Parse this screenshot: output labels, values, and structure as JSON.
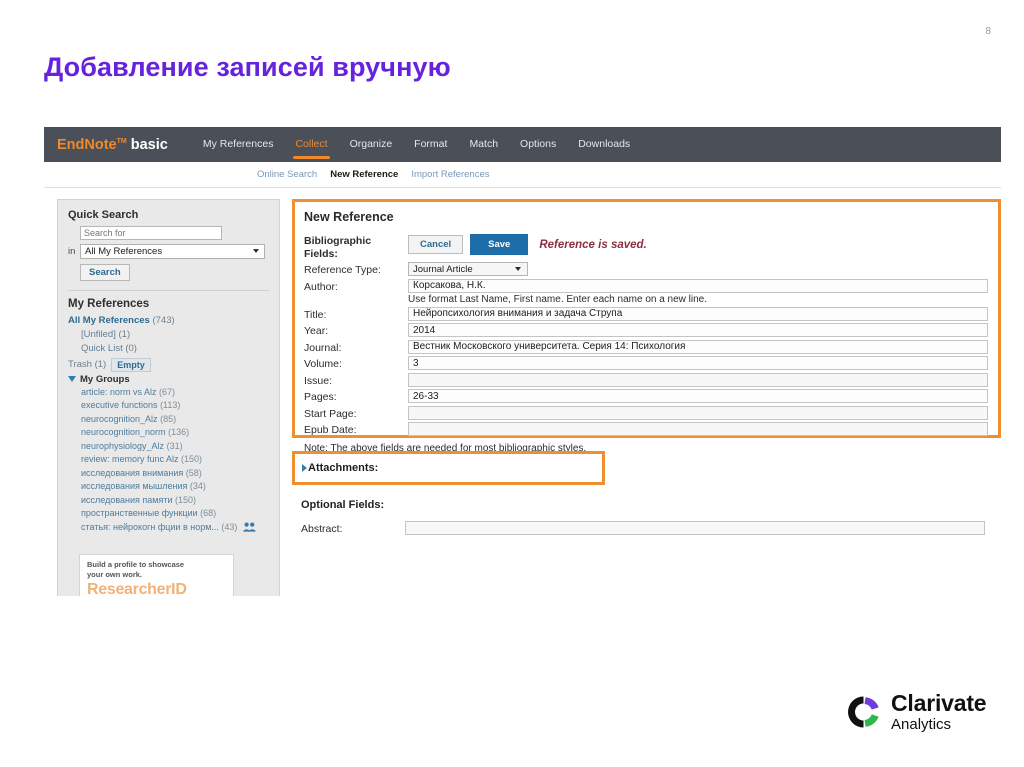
{
  "slide": {
    "number": "8",
    "title": "Добавление записей вручную"
  },
  "nav": {
    "brand_en": "EndNote",
    "brand_tm": "TM",
    "brand_basic": "basic",
    "items": [
      {
        "label": "My References",
        "active": false
      },
      {
        "label": "Collect",
        "active": true
      },
      {
        "label": "Organize",
        "active": false
      },
      {
        "label": "Format",
        "active": false
      },
      {
        "label": "Match",
        "active": false
      },
      {
        "label": "Options",
        "active": false
      },
      {
        "label": "Downloads",
        "active": false
      }
    ],
    "subnav": [
      {
        "label": "Online Search",
        "current": false
      },
      {
        "label": "New Reference",
        "current": true
      },
      {
        "label": "Import References",
        "current": false
      }
    ]
  },
  "sidebar": {
    "quick_search_heading": "Quick Search",
    "search_placeholder": "Search for",
    "in_label": "in",
    "scope_selected": "All My References",
    "search_button": "Search",
    "my_references_heading": "My References",
    "all_refs_label": "All My References",
    "all_refs_count": "(743)",
    "unfiled_label": "[Unfiled]",
    "unfiled_count": "(1)",
    "quick_list_label": "Quick List",
    "quick_list_count": "(0)",
    "trash_label": "Trash",
    "trash_count": "(1)",
    "empty_button": "Empty",
    "my_groups_label": "My Groups",
    "groups": [
      {
        "label": "article: norm vs Alz",
        "count": "(67)",
        "shared": false
      },
      {
        "label": "executive functions",
        "count": "(113)",
        "shared": false
      },
      {
        "label": "neurocognition_Alz",
        "count": "(85)",
        "shared": false
      },
      {
        "label": "neurocognition_norm",
        "count": "(136)",
        "shared": false
      },
      {
        "label": "neurophysiology_Alz",
        "count": "(31)",
        "shared": false
      },
      {
        "label": "review: memory func Alz",
        "count": "(150)",
        "shared": false
      },
      {
        "label": "исследования внимания",
        "count": "(58)",
        "shared": false
      },
      {
        "label": "исследования мышления",
        "count": "(34)",
        "shared": false
      },
      {
        "label": "исследования памяти",
        "count": "(150)",
        "shared": false
      },
      {
        "label": "пространственные функции",
        "count": "(68)",
        "shared": false
      },
      {
        "label": "статья: нейрокогн фции в норм...",
        "count": "(43)",
        "shared": true
      }
    ],
    "promo_line1": "Build a profile to showcase",
    "promo_line2": "your own work.",
    "promo_brand": "ResearcherID"
  },
  "main": {
    "panel_title": "New Reference",
    "bibliographic_label_l1": "Bibliographic",
    "bibliographic_label_l2": "Fields:",
    "cancel_button": "Cancel",
    "save_button": "Save",
    "saved_message": "Reference is saved.",
    "reference_type_label": "Reference Type:",
    "reference_type_value": "Journal Article",
    "author_label": "Author:",
    "author_value": "Корсакова, Н.К.",
    "author_hint": "Use format Last Name, First name. Enter each name on a new line.",
    "title_label": "Title:",
    "title_value": "Нейропсихология внимания и задача Струпа",
    "year_label": "Year:",
    "year_value": "2014",
    "journal_label": "Journal:",
    "journal_value": "Вестник Московского университета. Серия 14: Психология",
    "volume_label": "Volume:",
    "volume_value": "3",
    "issue_label": "Issue:",
    "issue_value": "",
    "pages_label": "Pages:",
    "pages_value": "26-33",
    "start_page_label": "Start Page:",
    "start_page_value": "",
    "epub_date_label": "Epub Date:",
    "epub_date_value": "",
    "note": "Note: The above fields are needed for most bibliographic styles.",
    "attachments_label": "Attachments:",
    "optional_fields_label": "Optional Fields:",
    "abstract_label": "Abstract:",
    "abstract_value": ""
  },
  "logo": {
    "name": "Clarivate",
    "subname": "Analytics"
  },
  "colors": {
    "title_purple": "#6622dd",
    "nav_dark": "#4a4f58",
    "accent_orange": "#f0892a",
    "highlight_orange": "#ef8f30",
    "save_blue": "#1d6ea8",
    "saved_red": "#8c2f3e",
    "link_blue": "#2f6b8f"
  }
}
